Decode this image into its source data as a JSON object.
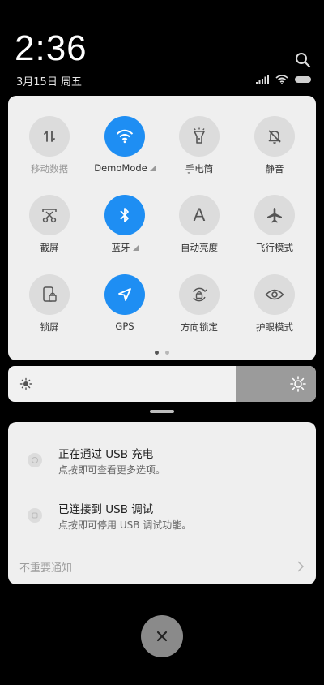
{
  "status": {
    "time": "2:36",
    "date": "3月15日 周五"
  },
  "quick_settings": {
    "tiles": [
      {
        "label": "移动数据",
        "icon": "mobile-data-icon",
        "active": false
      },
      {
        "label": "DemoMode",
        "icon": "wifi-icon",
        "active": true
      },
      {
        "label": "手电筒",
        "icon": "flashlight-icon",
        "active": false
      },
      {
        "label": "静音",
        "icon": "bell-off-icon",
        "active": false
      },
      {
        "label": "截屏",
        "icon": "scissors-icon",
        "active": false
      },
      {
        "label": "蓝牙",
        "icon": "bluetooth-icon",
        "active": true
      },
      {
        "label": "自动亮度",
        "icon": "auto-brightness-icon",
        "active": false
      },
      {
        "label": "飞行模式",
        "icon": "airplane-icon",
        "active": false
      },
      {
        "label": "锁屏",
        "icon": "lock-screen-icon",
        "active": false
      },
      {
        "label": "GPS",
        "icon": "location-icon",
        "active": true
      },
      {
        "label": "方向锁定",
        "icon": "rotation-lock-icon",
        "active": false
      },
      {
        "label": "护眼模式",
        "icon": "eye-icon",
        "active": false
      }
    ],
    "auto_brightness_glyph": "A"
  },
  "brightness": {
    "level": 0.74
  },
  "notifications": [
    {
      "title": "正在通过 USB 充电",
      "subtitle": "点按即可查看更多选项。"
    },
    {
      "title": "已连接到 USB 调试",
      "subtitle": "点按即可停用 USB 调试功能。"
    }
  ],
  "unimportant_label": "不重要通知",
  "colors": {
    "accent": "#1e8ef3",
    "panel": "#efefef",
    "tile_off": "#dcdcdc"
  }
}
